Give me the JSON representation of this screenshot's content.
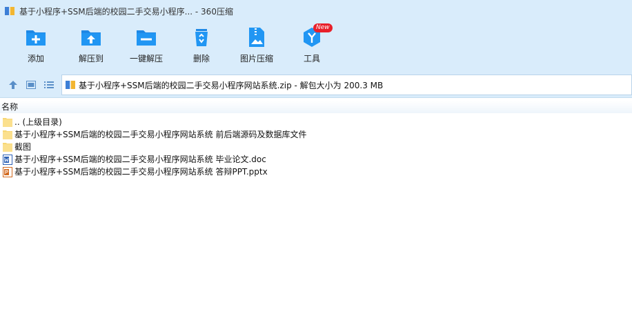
{
  "window": {
    "title": "基于小程序+SSM后端的校园二手交易小程序... - 360压缩"
  },
  "toolbar": {
    "items": [
      {
        "label": "添加",
        "icon": "add-folder-icon"
      },
      {
        "label": "解压到",
        "icon": "extract-to-icon"
      },
      {
        "label": "一键解压",
        "icon": "one-click-extract-icon"
      },
      {
        "label": "删除",
        "icon": "recycle-delete-icon"
      },
      {
        "label": "图片压缩",
        "icon": "image-compress-icon"
      },
      {
        "label": "工具",
        "icon": "tools-icon",
        "badge": "New"
      }
    ]
  },
  "addressbar": {
    "path": "基于小程序+SSM后端的校园二手交易小程序网站系统.zip - 解包大小为 200.3 MB"
  },
  "list": {
    "column_name": "名称",
    "items": [
      {
        "name": ".. (上级目录)",
        "type": "folder"
      },
      {
        "name": "基于小程序+SSM后端的校园二手交易小程序网站系统 前后端源码及数据库文件",
        "type": "folder"
      },
      {
        "name": "截图",
        "type": "folder"
      },
      {
        "name": "基于小程序+SSM后端的校园二手交易小程序网站系统 毕业论文.doc",
        "type": "doc"
      },
      {
        "name": "基于小程序+SSM后端的校园二手交易小程序网站系统 答辩PPT.pptx",
        "type": "pptx"
      }
    ]
  },
  "colors": {
    "toolbar_bg": "#d9ecfb",
    "icon_blue": "#1e88e5",
    "badge_red": "#e8202a",
    "folder_yellow": "#f7d775"
  }
}
